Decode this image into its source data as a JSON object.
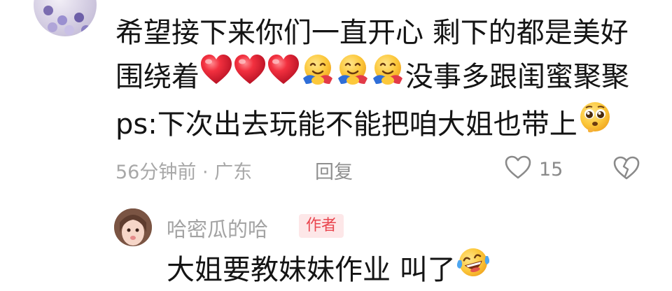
{
  "comment": {
    "lines": [
      "希望接下来你们一直开心  剩下的都是美好",
      "围绕着",
      "没事多跟闺蜜聚聚",
      "ps:下次出去玩能不能把咱大姐也带上"
    ],
    "time_location": "56分钟前 · 广东",
    "reply_label": "回复",
    "like_count": "15",
    "icons": [
      "red-heart-icon",
      "hugging-face-icon",
      "pleading-face-icon",
      "heart-outline-icon",
      "broken-heart-outline-icon"
    ]
  },
  "reply": {
    "username": "哈密瓜的哈",
    "badge": "作者",
    "text": "大姐要教妹妹作业 叫了",
    "icons": [
      "laughing-tears-face-icon"
    ]
  },
  "colors": {
    "badge_text": "#e9464f",
    "badge_bg": "#fde7e8",
    "meta_text": "#a8a8a8",
    "heart_red": "#e8243a"
  }
}
